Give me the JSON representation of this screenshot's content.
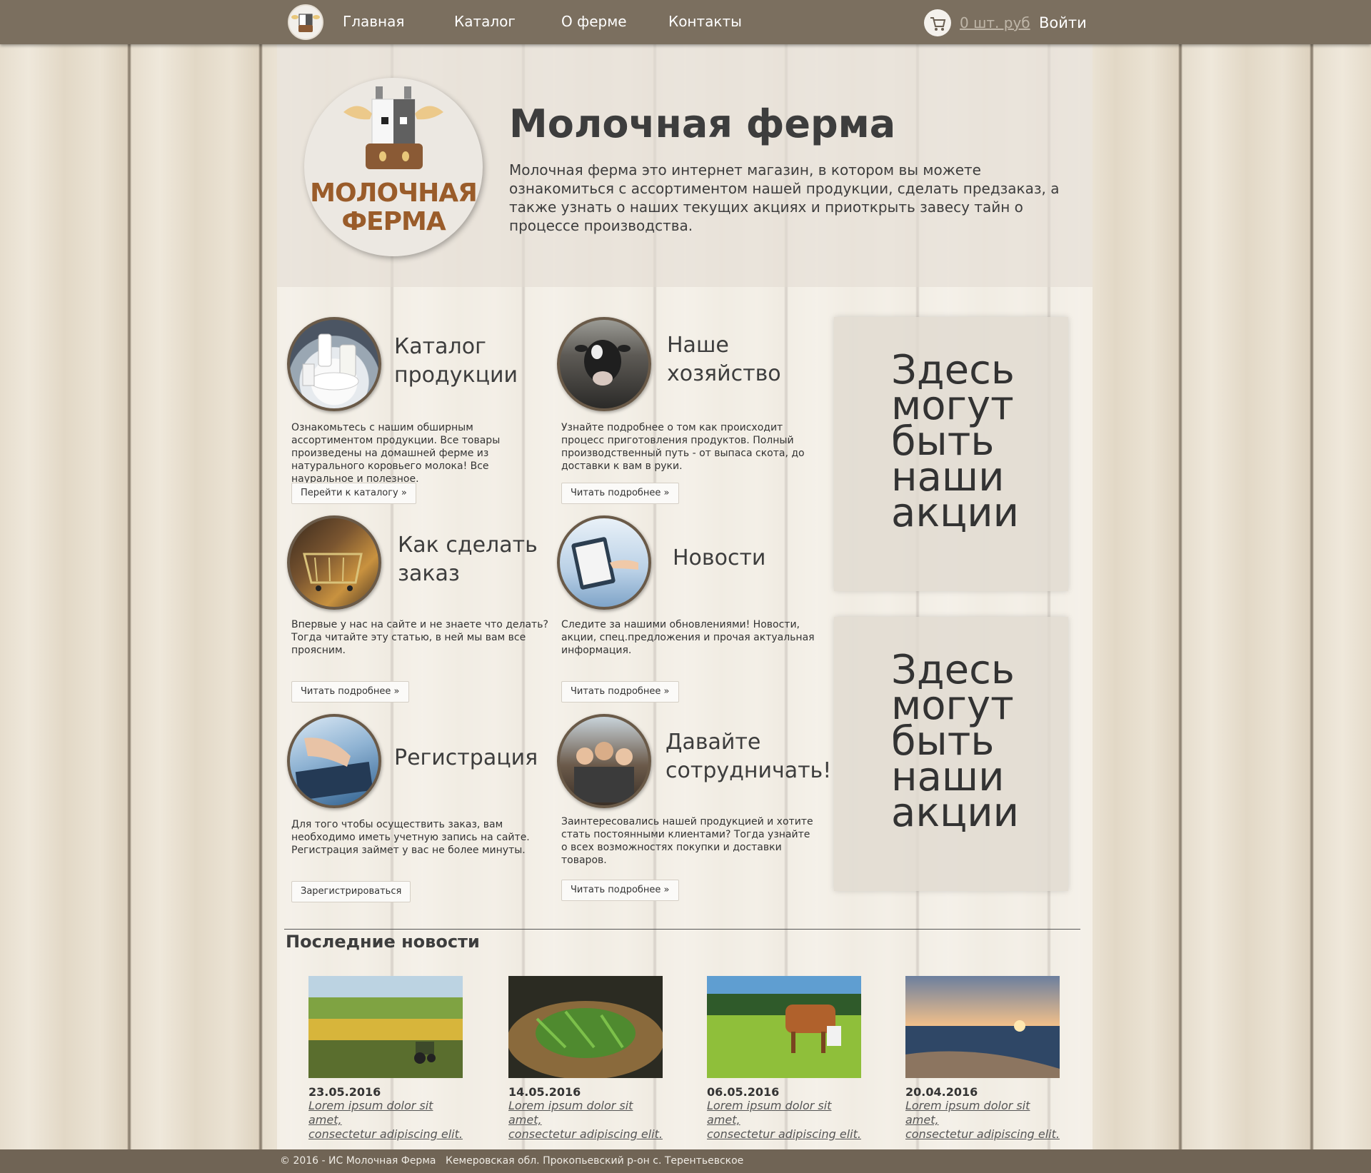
{
  "nav": {
    "items": [
      {
        "label": "Главная"
      },
      {
        "label": "Каталог"
      },
      {
        "label": "О ферме"
      },
      {
        "label": "Контакты"
      }
    ],
    "cart": "0 шт. руб",
    "login": "Войти"
  },
  "hero": {
    "logo_text_1": "МОЛОЧНАЯ",
    "logo_text_2": "ФЕРМА",
    "title": "Молочная ферма",
    "description": "Молочная ферма это интернет магазин, в котором вы можете ознакомиться с ассортиментом нашей продукции, сделать предзаказ, а также узнать о наших текущих акциях и приоткрыть завесу тайн о процессе производства."
  },
  "features": [
    {
      "title_1": "Каталог",
      "title_2": "продукции",
      "text": "Ознакомьтесь с нашим обширным ассортиментом продукции. Все товары произведены на домашней ферме из натурального коровьего молока! Все науральное и полезное.",
      "button": "Перейти к каталогу »"
    },
    {
      "title_1": "Наше",
      "title_2": "хозяйство",
      "text": "Узнайте подробнее о том как происходит процесс приготовления продуктов. Полный производственный путь - от выпаса скота, до доставки к вам в руки.",
      "button": "Читать подробнее »"
    },
    {
      "title_1": "Как сделать",
      "title_2": "заказ",
      "text": "Впервые у нас на сайте и не знаете что делать? Тогда читайте эту статью, в ней мы вам все проясним.",
      "button": "Читать подробнее »"
    },
    {
      "title_1": "Новости",
      "title_2": "",
      "text": "Следите за нашими обновлениями! Новости, акции, спец.предложения и прочая актуальная информация.",
      "button": "Читать подробнее »"
    },
    {
      "title_1": "Регистрация",
      "title_2": "",
      "text": "Для того чтобы осуществить заказ, вам необходимо иметь учетную запись на сайте. Регистрация займет у вас не более минуты.",
      "button": "Зарегистрироваться"
    },
    {
      "title_1": "Давайте",
      "title_2": "сотрудничать!",
      "text": "Заинтересовались нашей продукцией и хотите стать постоянными клиентами? Тогда узнайте о всех возможностях покупки и доставки товаров.",
      "button": "Читать подробнее »"
    }
  ],
  "promos": [
    {
      "text": "Здесь могут быть наши акции"
    },
    {
      "text": "Здесь могут быть наши акции"
    }
  ],
  "news": {
    "heading": "Последние новости",
    "items": [
      {
        "date": "23.05.2016",
        "text_1": "Lorem ipsum dolor sit amet,",
        "text_2": "consectetur adipiscing elit."
      },
      {
        "date": "14.05.2016",
        "text_1": "Lorem ipsum dolor sit amet,",
        "text_2": "consectetur adipiscing elit."
      },
      {
        "date": "06.05.2016",
        "text_1": "Lorem ipsum dolor sit amet,",
        "text_2": "consectetur adipiscing elit."
      },
      {
        "date": "20.04.2016",
        "text_1": "Lorem ipsum dolor sit amet,",
        "text_2": "consectetur adipiscing elit."
      }
    ]
  },
  "footer": {
    "copyright": "© 2016 - ИС Молочная Ферма",
    "address": "Кемеровская обл. Прокопьевский р-он с. Терентьевское"
  },
  "colors": {
    "topbar": "#7b6f5f",
    "footer": "#706455",
    "logo_brown": "#9a5c2a"
  }
}
